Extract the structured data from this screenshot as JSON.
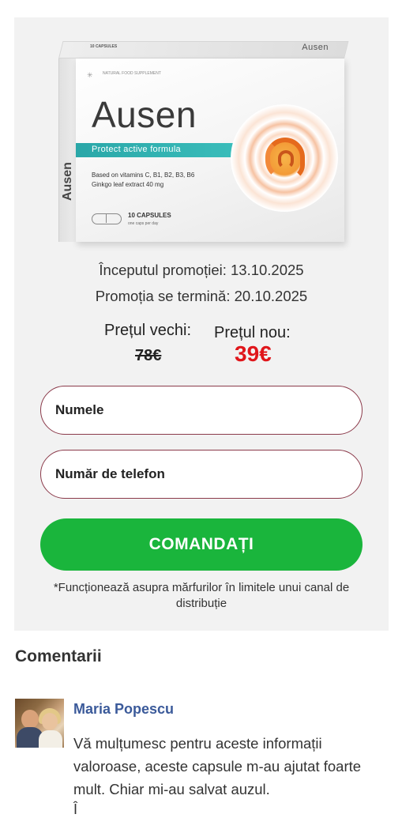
{
  "product": {
    "brand": "Ausen",
    "tagline": "Protect active formula",
    "top_label": "10 CAPSULES",
    "top_brand": "Ausen",
    "badge": "NATURAL FOOD SUPPLEMENT",
    "vitamins_line1": "Based on vitamins C, B1, B2, B3, B6",
    "vitamins_line2": "Ginkgo leaf extract 40 mg",
    "capsules": "10 CAPSULES",
    "capsules_sub": "one caps per day"
  },
  "promo": {
    "start": "Începutul promoției: 13.10.2025",
    "end": "Promoția se termină: 20.10.2025"
  },
  "price": {
    "old_label": "Prețul vechi:",
    "old_value": "78€",
    "new_label": "Prețul nou:",
    "new_value": "39€"
  },
  "form": {
    "name_placeholder": "Numele",
    "phone_placeholder": "Număr de telefon",
    "submit_label": "COMANDAȚI",
    "note": "*Funcționează asupra mărfurilor în limitele unui canal de distribuție"
  },
  "comments": {
    "title": "Comentarii",
    "items": [
      {
        "author": "Maria Popescu",
        "text": "Vă mulțumesc pentru aceste informații valoroase, aceste capsule m-au ajutat foarte mult. Chiar mi-au salvat auzul."
      }
    ],
    "next_hint": "Î"
  },
  "colors": {
    "accent_green": "#1ab53c",
    "new_price_red": "#e0161b",
    "author_blue": "#3b5a9a",
    "field_border": "#8b3a4a"
  }
}
